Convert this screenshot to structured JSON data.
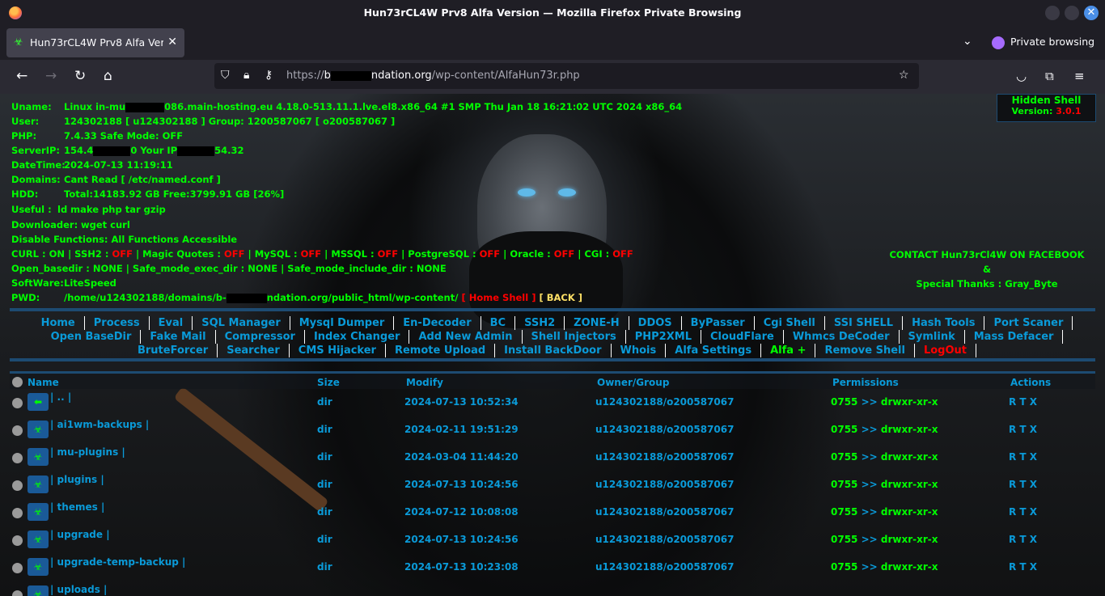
{
  "window": {
    "title": "Hun73rCL4W Prv8 Alfa Version — Mozilla Firefox Private Browsing"
  },
  "tab": {
    "label": "Hun73rCL4W Prv8 Alfa Vers"
  },
  "private_label": "Private browsing",
  "address": {
    "prefix": "https://",
    "host_part1": "b",
    "host_part2": "ndation.org",
    "path": "/wp-content/AlfaHun73r.php"
  },
  "info": {
    "uname_label": "Uname:",
    "uname_a": "Linux in-mu",
    "uname_b": "086.main-hosting.eu 4.18.0-513.11.1.lve.el8.x86_64 #1 SMP Thu Jan 18 16:21:02 UTC 2024 x86_64",
    "user_label": "User:",
    "user_value": "124302188 [ u124302188 ] Group: 1200587067 [ o200587067 ]",
    "php_label": "PHP:",
    "php_value": "7.4.33 Safe Mode: OFF",
    "serverip_label": "ServerIP:",
    "serverip_a": "154.4",
    "serverip_b": "0 Your IP",
    "serverip_c": "54.32",
    "datetime_label": "DateTime:",
    "datetime_value": "2024-07-13 11:19:11",
    "domains_label": "Domains:",
    "domains_value": "Cant Read [ /etc/named.conf ]",
    "hdd_label": "HDD:",
    "hdd_value": "Total:14183.92 GB Free:3799.91 GB [26%]",
    "useful_label": "Useful :",
    "useful_value": "ld make php tar gzip",
    "downloader_label": "Downloader:",
    "downloader_value": "wget curl",
    "disable_label": "Disable Functions:",
    "disable_value": "All Functions Accessible",
    "curl_line": {
      "curl": "CURL : ON | SSH2 : ",
      "off1": "OFF",
      "magic": " | Magic Quotes : ",
      "off2": "OFF",
      "mysql": " | MySQL : ",
      "off3": "OFF",
      "mssql": " | MSSQL : ",
      "off4": "OFF",
      "pg": " | PostgreSQL : ",
      "off5": "OFF",
      "oracle": " | Oracle : ",
      "off6": "OFF",
      "cgi": " | CGI : ",
      "off7": "OFF"
    },
    "open_basedir": "Open_basedir : NONE | Safe_mode_exec_dir : NONE | Safe_mode_include_dir : NONE",
    "software_label": "SoftWare:",
    "software_value": "LiteSpeed",
    "pwd_label": "PWD:",
    "pwd_a": "/home/u124302188/domains/b-",
    "pwd_b": "ndation.org/public_html/wp-content/",
    "home_shell": "[ Home Shell ]",
    "back": "[ BACK ]"
  },
  "hidden_box": {
    "title": "Hidden Shell",
    "version_label": "Version: ",
    "version_value": "3.0.1"
  },
  "contact": {
    "line1": "CONTACT Hun73rCl4W ON FACEBOOK",
    "line2": "&",
    "line3": "Special Thanks : Gray_Byte"
  },
  "menu": {
    "row1": [
      "Home",
      "Process",
      "Eval",
      "SQL Manager",
      "Mysql Dumper",
      "En-Decoder",
      "BC",
      "SSH2",
      "ZONE-H",
      "DDOS",
      "ByPasser",
      "Cgi Shell",
      "SSI SHELL",
      "Hash Tools",
      "Port Scaner"
    ],
    "row2": [
      "Open BaseDir",
      "Fake Mail",
      "Compressor",
      "Index Changer",
      "Add New Admin",
      "Shell Injectors",
      "PHP2XML",
      "CloudFlare",
      "Whmcs DeCoder",
      "Symlink",
      "Mass Defacer"
    ],
    "row3": [
      "BruteForcer",
      "Searcher",
      "CMS Hijacker",
      "Remote Upload",
      "Install BackDoor",
      "Whois",
      "Alfa Settings",
      "Alfa +",
      "Remove Shell",
      "LogOut"
    ]
  },
  "table": {
    "headers": {
      "name": "Name",
      "size": "Size",
      "modify": "Modify",
      "owner": "Owner/Group",
      "perms": "Permissions",
      "actions": "Actions"
    },
    "rows": [
      {
        "name": "| .. |",
        "size": "dir",
        "modify": "2024-07-13 10:52:34",
        "owner": "u124302188/o200587067",
        "perm_num": "0755",
        "perm_str": "drwxr-xr-x",
        "actions": "R T X",
        "icon": "back-arrow-icon"
      },
      {
        "name": "| ai1wm-backups |",
        "size": "dir",
        "modify": "2024-02-11 19:51:29",
        "owner": "u124302188/o200587067",
        "perm_num": "0755",
        "perm_str": "drwxr-xr-x",
        "actions": "R T X",
        "icon": "folder-icon"
      },
      {
        "name": "| mu-plugins |",
        "size": "dir",
        "modify": "2024-03-04 11:44:20",
        "owner": "u124302188/o200587067",
        "perm_num": "0755",
        "perm_str": "drwxr-xr-x",
        "actions": "R T X",
        "icon": "folder-icon"
      },
      {
        "name": "| plugins |",
        "size": "dir",
        "modify": "2024-07-13 10:24:56",
        "owner": "u124302188/o200587067",
        "perm_num": "0755",
        "perm_str": "drwxr-xr-x",
        "actions": "R T X",
        "icon": "folder-icon"
      },
      {
        "name": "| themes |",
        "size": "dir",
        "modify": "2024-07-12 10:08:08",
        "owner": "u124302188/o200587067",
        "perm_num": "0755",
        "perm_str": "drwxr-xr-x",
        "actions": "R T X",
        "icon": "folder-icon"
      },
      {
        "name": "| upgrade |",
        "size": "dir",
        "modify": "2024-07-13 10:24:56",
        "owner": "u124302188/o200587067",
        "perm_num": "0755",
        "perm_str": "drwxr-xr-x",
        "actions": "R T X",
        "icon": "folder-icon"
      },
      {
        "name": "| upgrade-temp-backup |",
        "size": "dir",
        "modify": "2024-07-13 10:23:08",
        "owner": "u124302188/o200587067",
        "perm_num": "0755",
        "perm_str": "drwxr-xr-x",
        "actions": "R T X",
        "icon": "folder-icon"
      },
      {
        "name": "| uploads |",
        "size": "",
        "modify": "",
        "owner": "",
        "perm_num": "",
        "perm_str": "",
        "actions": "",
        "icon": "folder-icon"
      }
    ]
  },
  "colors": {
    "accent_blue": "#0a9ad8",
    "green": "#00ff00",
    "red": "#ff0000",
    "border": "#1d4b72"
  }
}
